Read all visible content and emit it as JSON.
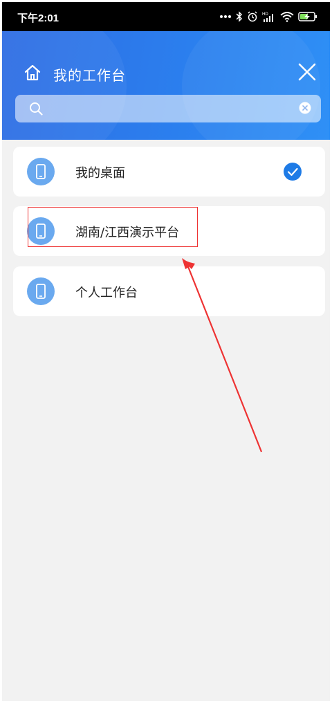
{
  "status_bar": {
    "time": "下午2:01",
    "icons": [
      "more-dots-icon",
      "bluetooth-icon",
      "alarm-icon",
      "signal-hd-icon",
      "wifi-icon",
      "battery-charging-icon"
    ]
  },
  "header": {
    "title": "我的工作台",
    "search": {
      "value": "",
      "placeholder": ""
    }
  },
  "workspaces": [
    {
      "label": "我的桌面",
      "selected": true
    },
    {
      "label": "湖南/江西演示平台",
      "selected": false
    },
    {
      "label": "个人工作台",
      "selected": false
    }
  ],
  "colors": {
    "header_start": "#2f6de3",
    "header_end": "#2f90f6",
    "accent": "#1e7be6",
    "item_icon": "#6aa9ef",
    "annotation": "#ee3333"
  }
}
